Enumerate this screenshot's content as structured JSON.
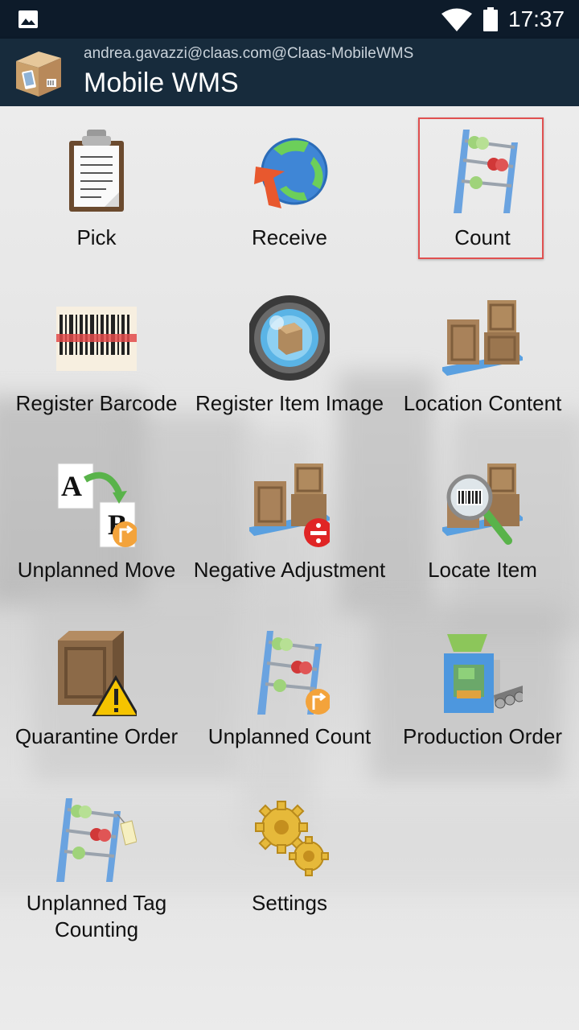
{
  "status_bar": {
    "time": "17:37",
    "icons": [
      "image-icon",
      "wifi-icon",
      "battery-icon"
    ]
  },
  "app_bar": {
    "account": "andrea.gavazzi@claas.com@Claas-MobileWMS",
    "title": "Mobile WMS",
    "logo": "box-phone-logo"
  },
  "menu": {
    "selected": "Count",
    "items": [
      {
        "label": "Pick",
        "icon": "clipboard-icon"
      },
      {
        "label": "Receive",
        "icon": "receive-globe-icon"
      },
      {
        "label": "Count",
        "icon": "abacus-icon"
      },
      {
        "label": "Register Barcode",
        "icon": "barcode-icon"
      },
      {
        "label": "Register Item Image",
        "icon": "camera-lens-icon"
      },
      {
        "label": "Location Content",
        "icon": "boxes-pallet-icon"
      },
      {
        "label": "Unplanned Move",
        "icon": "move-a-to-b-icon"
      },
      {
        "label": "Negative Adjustment",
        "icon": "boxes-minus-icon"
      },
      {
        "label": "Locate Item",
        "icon": "boxes-magnifier-icon"
      },
      {
        "label": "Quarantine Order",
        "icon": "crate-warning-icon"
      },
      {
        "label": "Unplanned Count",
        "icon": "abacus-arrow-icon"
      },
      {
        "label": "Production Order",
        "icon": "production-machine-icon"
      },
      {
        "label": "Unplanned Tag Counting",
        "icon": "abacus-tag-icon"
      },
      {
        "label": "Settings",
        "icon": "gears-icon"
      }
    ]
  },
  "colors": {
    "status_bar": "#0d1b2a",
    "app_bar": "#172b3c",
    "selection_border": "#e05050"
  }
}
